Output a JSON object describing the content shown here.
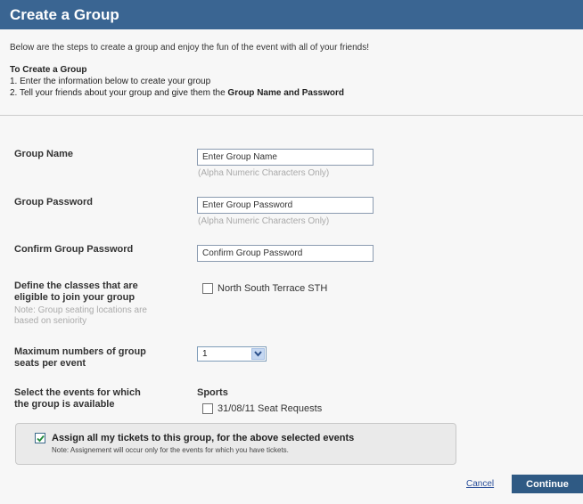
{
  "header": {
    "title": "Create a Group"
  },
  "intro": "Below are the steps to create a group and enjoy the fun of the event with all of your friends!",
  "steps": {
    "title": "To Create a Group",
    "step1": "1. Enter the information below to create your group",
    "step2_prefix": "2. Tell your friends about your group and give them the ",
    "step2_bold": "Group Name and Password"
  },
  "form": {
    "group_name": {
      "label": "Group Name",
      "placeholder": "Enter Group Name",
      "hint": "(Alpha Numeric Characters Only)"
    },
    "group_password": {
      "label": "Group Password",
      "placeholder": "Enter Group Password",
      "hint": "(Alpha Numeric Characters Only)"
    },
    "confirm_password": {
      "label": "Confirm Group Password",
      "placeholder": "Confirm Group Password"
    },
    "classes": {
      "label_line1": "Define the classes that are",
      "label_line2": "eligible to join your group",
      "note_line1": "Note: Group seating locations are",
      "note_line2": "based on seniority",
      "option": "North South Terrace STH",
      "checked": false
    },
    "max_seats": {
      "label_line1": "Maximum numbers of group",
      "label_line2": "seats per event",
      "value": "1"
    },
    "events": {
      "label_line1": "Select the events for which",
      "label_line2": "the group is available",
      "category": "Sports",
      "option": "31/08/11 Seat Requests",
      "checked": false
    }
  },
  "assign": {
    "title": "Assign all my tickets to this group, for the above selected events",
    "note": "Note: Assignement will occur only for the events for which you have tickets.",
    "checked": true
  },
  "actions": {
    "cancel": "Cancel",
    "continue": "Continue"
  },
  "colors": {
    "header_bg": "#3a6592",
    "button_bg": "#2f5a84",
    "link": "#2a4f9a"
  }
}
